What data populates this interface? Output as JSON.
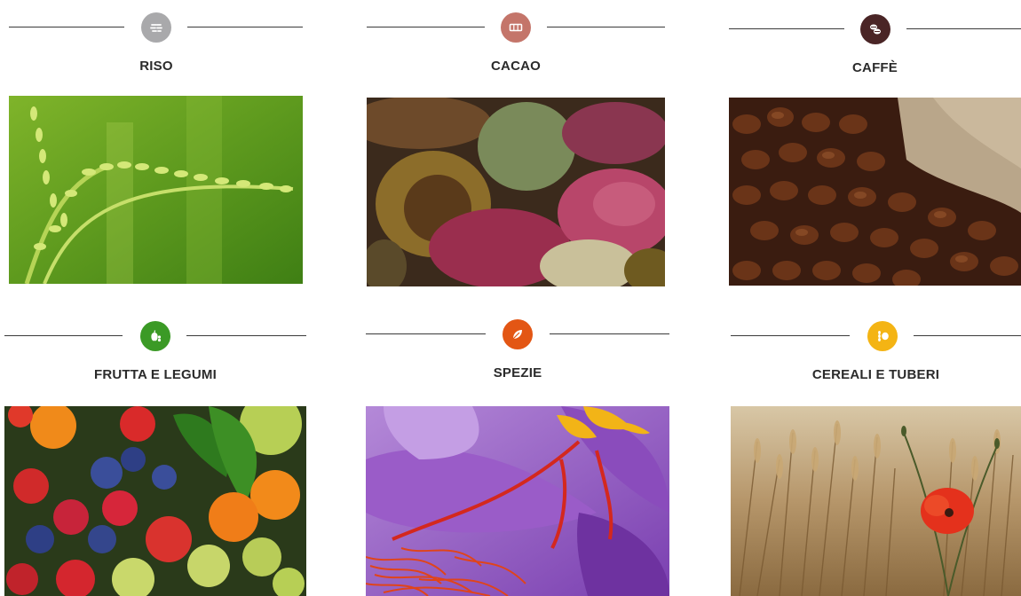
{
  "categories": [
    {
      "title": "RISO",
      "icon": "rice-icon",
      "icon_color": "#a9a9ab",
      "photo": "rice-plant-photo"
    },
    {
      "title": "CACAO",
      "icon": "cocoa-bar-icon",
      "icon_color": "#c4756a",
      "photo": "cocoa-pods-photo"
    },
    {
      "title": "CAFFÈ",
      "icon": "coffee-beans-icon",
      "icon_color": "#4a2526",
      "photo": "coffee-beans-photo"
    },
    {
      "title": "FRUTTA E LEGUMI",
      "icon": "fruit-icon",
      "icon_color": "#3b9a26",
      "photo": "mixed-fruit-photo"
    },
    {
      "title": "SPEZIE",
      "icon": "leaf-icon",
      "icon_color": "#e35614",
      "photo": "saffron-flower-photo"
    },
    {
      "title": "CEREALI E TUBERI",
      "icon": "grain-icon",
      "icon_color": "#f4b414",
      "photo": "wheat-field-poppy-photo"
    }
  ]
}
